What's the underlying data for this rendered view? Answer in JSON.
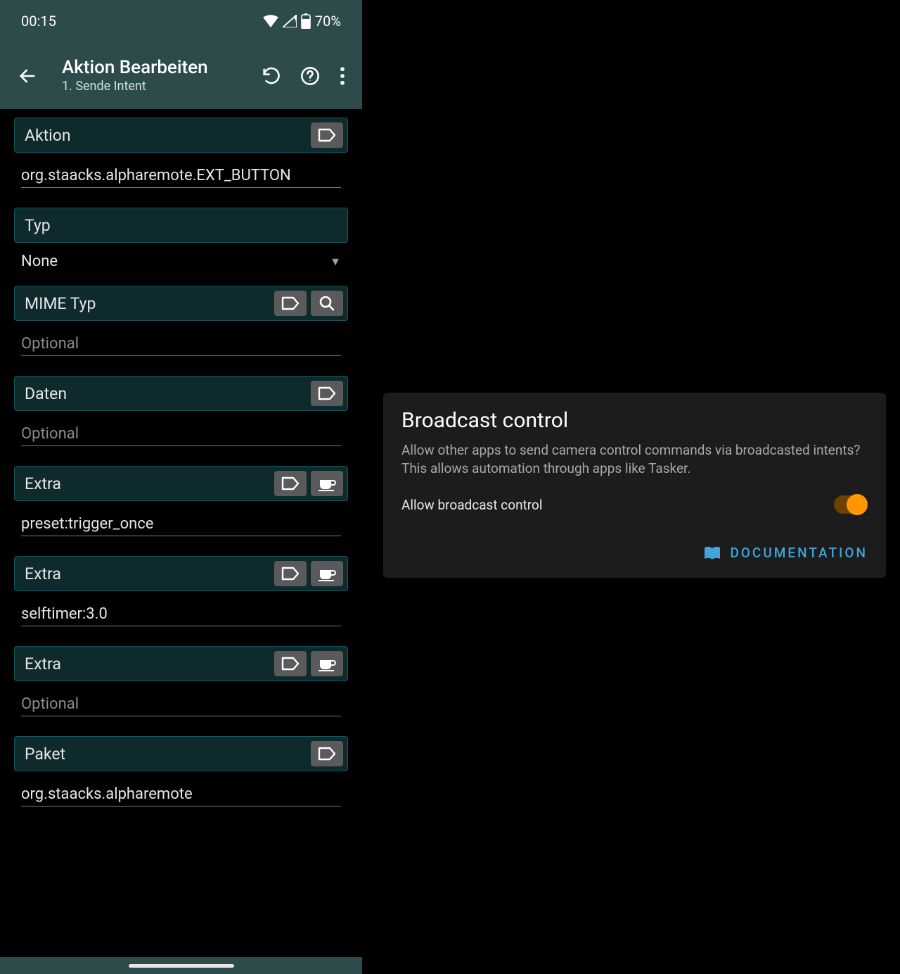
{
  "status_bar": {
    "time": "00:15",
    "battery": "70%"
  },
  "app_bar": {
    "title": "Aktion Bearbeiten",
    "subtitle": "1. Sende Intent"
  },
  "sections": {
    "aktion": {
      "label": "Aktion",
      "value": "org.staacks.alpharemote.EXT_BUTTON"
    },
    "typ": {
      "label": "Typ",
      "selected": "None"
    },
    "mimetyp": {
      "label": "MIME Typ",
      "placeholder": "Optional"
    },
    "daten": {
      "label": "Daten",
      "placeholder": "Optional"
    },
    "extra1": {
      "label": "Extra",
      "value": "preset:trigger_once"
    },
    "extra2": {
      "label": "Extra",
      "value": "selftimer:3.0"
    },
    "extra3": {
      "label": "Extra",
      "placeholder": "Optional"
    },
    "paket": {
      "label": "Paket",
      "value": "org.staacks.alpharemote"
    }
  },
  "card": {
    "title": "Broadcast control",
    "description": "Allow other apps to send camera control commands via broadcasted intents? This allows automation through apps like Tasker.",
    "toggle_label": "Allow broadcast control",
    "doc_label": "DOCUMENTATION"
  }
}
